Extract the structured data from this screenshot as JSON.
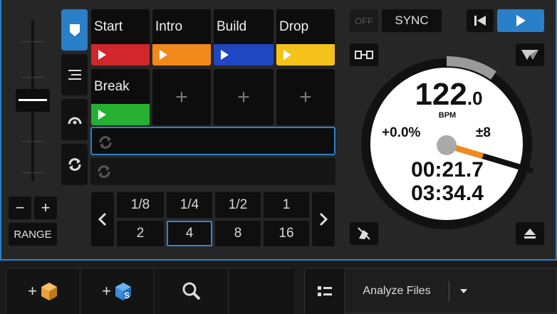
{
  "pitch": {
    "range_label": "RANGE",
    "minus_label": "−",
    "plus_label": "+"
  },
  "pads": [
    {
      "label": "Start",
      "color": "#d1262b"
    },
    {
      "label": "Intro",
      "color": "#f28a1b"
    },
    {
      "label": "Build",
      "color": "#1f47c2"
    },
    {
      "label": "Drop",
      "color": "#f5c21a"
    },
    {
      "label": "Break",
      "color": "#25b032"
    }
  ],
  "loop_sizes_top": [
    "1/8",
    "1/4",
    "1/2",
    "1"
  ],
  "loop_sizes_bottom": [
    "2",
    "4",
    "8",
    "16"
  ],
  "transport": {
    "off_label": "OFF",
    "sync_label": "SYNC"
  },
  "platter": {
    "bpm": "122",
    "bpm_decimal": ".0",
    "bpm_unit": "BPM",
    "pitch_percent": "+0.0%",
    "pitch_range": "±8",
    "elapsed": "00:21.7",
    "remaining": "03:34.4",
    "accent": "#f28a1b"
  },
  "browser": {
    "analyze_label": "Analyze Files"
  }
}
